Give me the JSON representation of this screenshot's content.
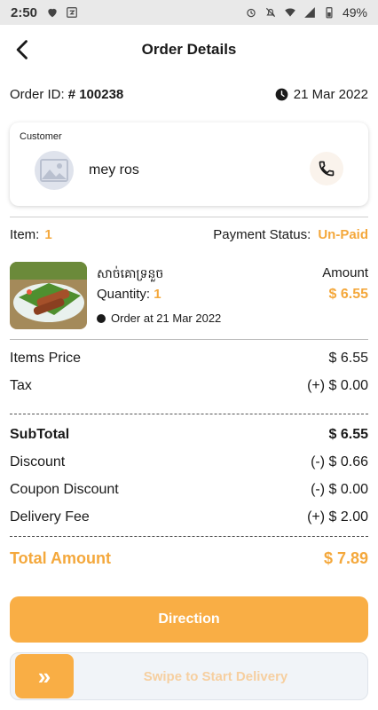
{
  "status_bar": {
    "time": "2:50",
    "battery": "49%"
  },
  "header": {
    "title": "Order Details"
  },
  "order": {
    "id_label": "Order ID:",
    "id_value": "# 100238",
    "date": "21 Mar 2022"
  },
  "customer": {
    "label": "Customer",
    "name": "mey ros"
  },
  "summary_row": {
    "item_label": "Item:",
    "item_count": "1",
    "payment_label": "Payment Status:",
    "payment_value": "Un-Paid"
  },
  "item": {
    "name": "សាច់គោទ្រនួច",
    "qty_label": "Quantity:",
    "qty_value": "1",
    "ordered_text": "Order at 21 Mar 2022",
    "amount_label": "Amount",
    "amount_value": "$ 6.55"
  },
  "pricing": {
    "items_price_label": "Items Price",
    "items_price_value": "$ 6.55",
    "tax_label": "Tax",
    "tax_value": "(+) $ 0.00",
    "subtotal_label": "SubTotal",
    "subtotal_value": "$ 6.55",
    "discount_label": "Discount",
    "discount_value": "(-) $ 0.66",
    "coupon_label": "Coupon Discount",
    "coupon_value": "(-) $ 0.00",
    "delivery_label": "Delivery Fee",
    "delivery_value": "(+) $ 2.00",
    "total_label": "Total Amount",
    "total_value": "$ 7.89"
  },
  "actions": {
    "direction_label": "Direction",
    "swipe_label": "Swipe to Start Delivery",
    "swipe_handle_glyph": "»"
  },
  "colors": {
    "accent": "#f9ae45",
    "accent_text": "#f4a83c"
  }
}
